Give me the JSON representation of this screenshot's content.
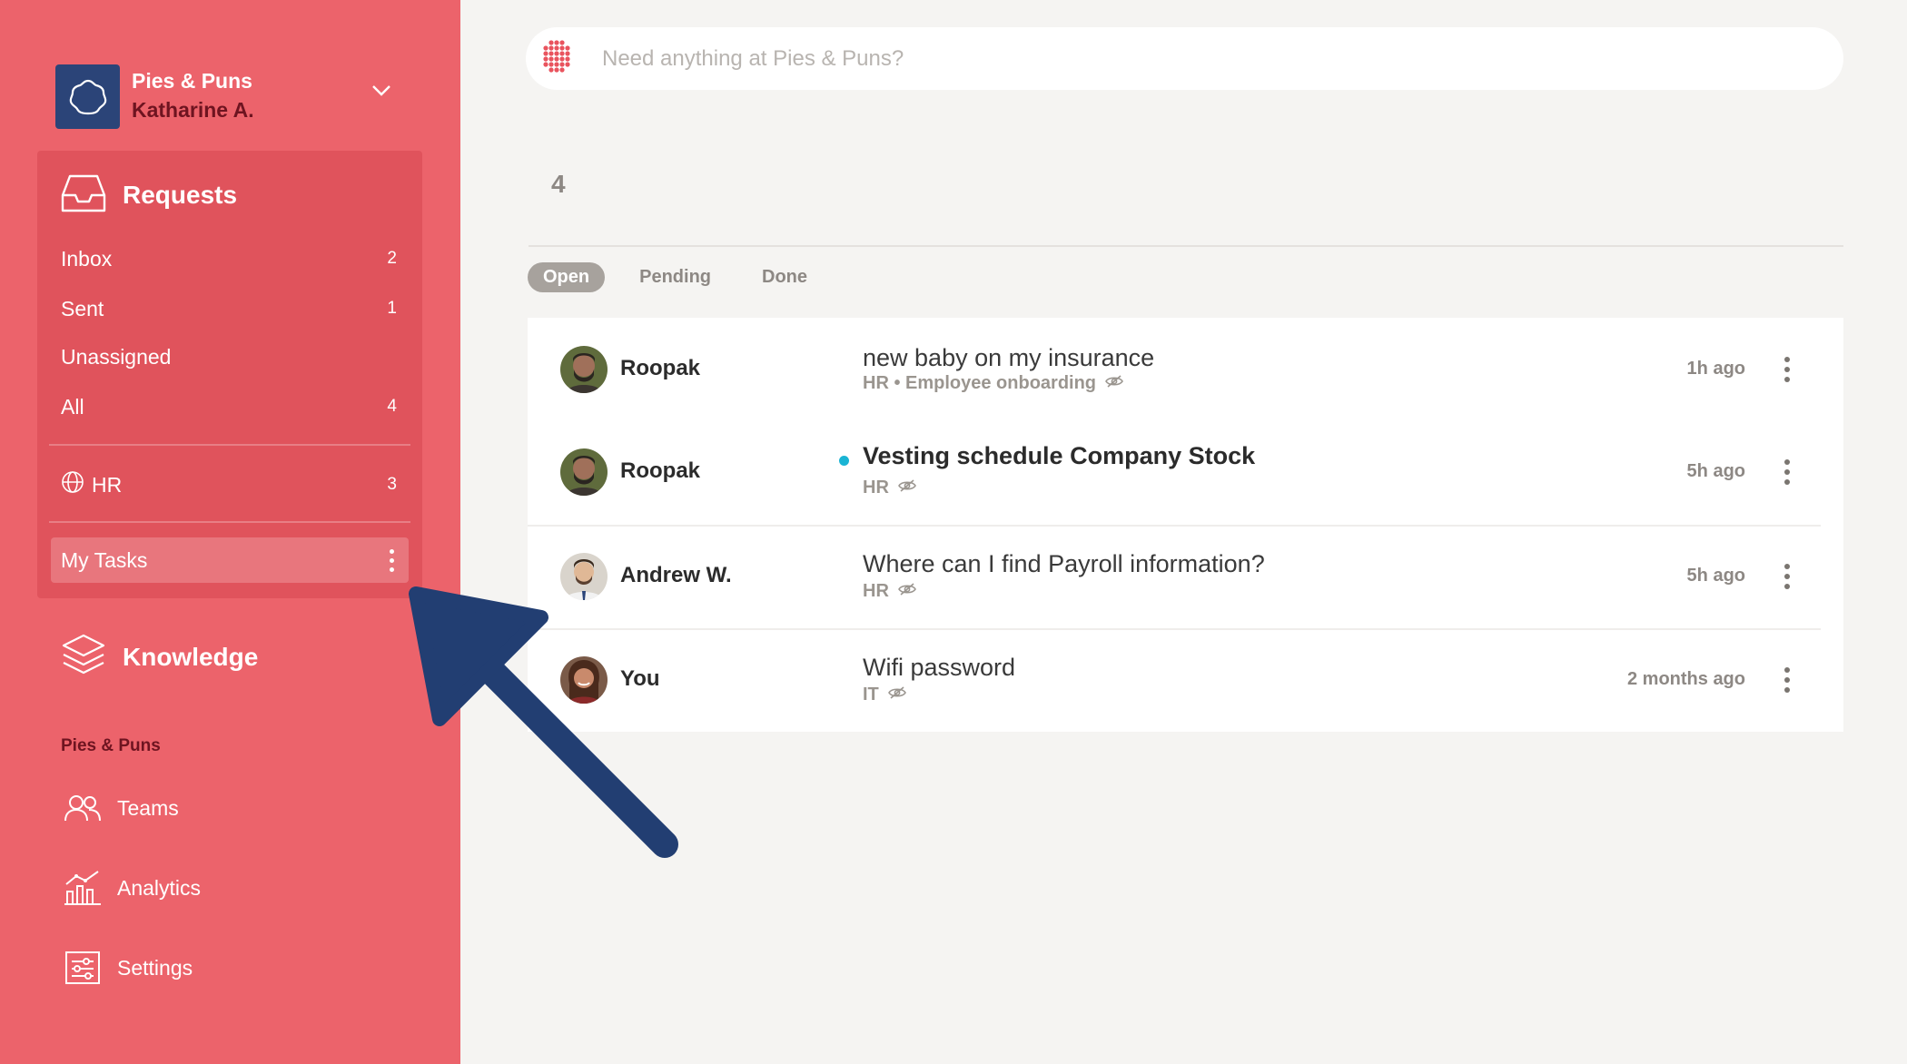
{
  "workspace": {
    "name": "Pies & Puns",
    "user": "Katharine A."
  },
  "requests": {
    "title": "Requests",
    "items": [
      {
        "label": "Inbox",
        "count": "2"
      },
      {
        "label": "Sent",
        "count": "1"
      },
      {
        "label": "Unassigned",
        "count": ""
      },
      {
        "label": "All",
        "count": "4"
      }
    ],
    "team": {
      "label": "HR",
      "count": "3"
    },
    "my_tasks": "My Tasks"
  },
  "knowledge": "Knowledge",
  "section_label": "Pies & Puns",
  "links": [
    {
      "label": "Teams",
      "icon": "teams-icon"
    },
    {
      "label": "Analytics",
      "icon": "analytics-icon"
    },
    {
      "label": "Settings",
      "icon": "settings-icon"
    }
  ],
  "search": {
    "placeholder": "Need anything at Pies & Puns?"
  },
  "list_count": "4",
  "tabs": [
    "Open",
    "Pending",
    "Done"
  ],
  "active_tab": "Open",
  "rows": [
    {
      "user": "Roopak",
      "subject": "new baby on my insurance",
      "meta": "HR • Employee onboarding",
      "time": "1h ago",
      "unread": false
    },
    {
      "user": "Roopak",
      "subject": "Vesting schedule Company Stock",
      "meta": "HR",
      "time": "5h ago",
      "unread": true
    },
    {
      "user": "Andrew W.",
      "subject": "Where can I find Payroll information?",
      "meta": "HR",
      "time": "5h ago",
      "unread": false
    },
    {
      "user": "You",
      "subject": "Wifi password",
      "meta": "IT",
      "time": "2 months ago",
      "unread": false
    }
  ],
  "colors": {
    "sidebar": "#ec636b",
    "panel": "#e0535c",
    "brand_dark": "#2b4478",
    "unread_dot": "#1ab4d4",
    "annotation_arrow": "#223e72"
  }
}
